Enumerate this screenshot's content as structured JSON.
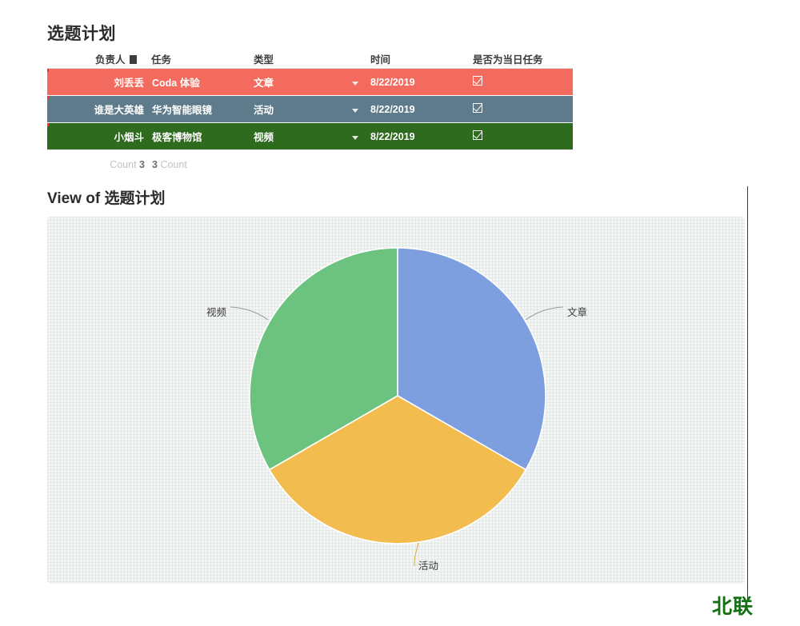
{
  "document": {
    "title": "选题计划",
    "view_title": "View of 选题计划",
    "watermark": "北联"
  },
  "table": {
    "columns": [
      {
        "key": "owner",
        "label": "负责人",
        "icon": "flag-square-icon"
      },
      {
        "key": "task",
        "label": "任务"
      },
      {
        "key": "type",
        "label": "类型"
      },
      {
        "key": "date",
        "label": "时间"
      },
      {
        "key": "today",
        "label": "是否为当日任务"
      }
    ],
    "rows": [
      {
        "owner": "刘丢丢",
        "task": "Coda 体验",
        "type": "文章",
        "date": "8/22/2019",
        "today_checked": true,
        "row_color": "#f26b5e"
      },
      {
        "owner": "谁是大英雄",
        "task": "华为智能眼镜",
        "type": "活动",
        "date": "8/22/2019",
        "today_checked": true,
        "row_color": "#5d7b8a"
      },
      {
        "owner": "小烟斗",
        "task": "极客博物馆",
        "type": "视频",
        "date": "8/22/2019",
        "today_checked": true,
        "row_color": "#2e6b1e"
      }
    ],
    "footer": {
      "owner_count_label": "Count",
      "owner_count_value": "3",
      "task_count_value": "3",
      "task_count_label": "Count"
    }
  },
  "chart_data": {
    "type": "pie",
    "title": "View of 选题计划",
    "categories": [
      "文章",
      "活动",
      "视频"
    ],
    "values": [
      1,
      1,
      1
    ],
    "percentages": [
      33.3,
      33.3,
      33.3
    ],
    "colors": [
      "#7d9fe0",
      "#f2bc4f",
      "#6cc37f"
    ],
    "start_angle_deg": 0,
    "direction": "clockwise",
    "labels_outside": true,
    "legend": "none",
    "grid": true,
    "annotations": [
      {
        "label": "文章",
        "side": "right"
      },
      {
        "label": "活动",
        "side": "bottom"
      },
      {
        "label": "视频",
        "side": "left"
      }
    ]
  }
}
